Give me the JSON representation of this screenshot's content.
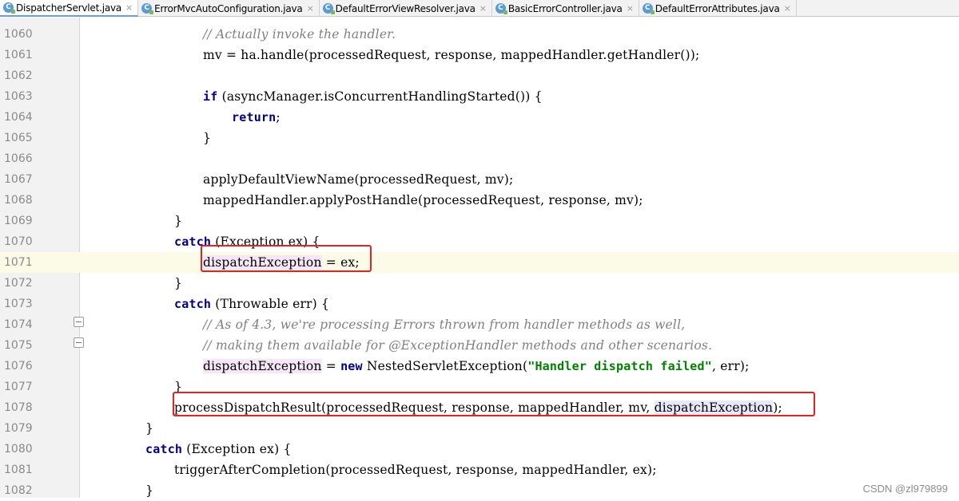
{
  "tabs": [
    {
      "label": "DispatcherServlet.java",
      "active": true
    },
    {
      "label": "ErrorMvcAutoConfiguration.java",
      "active": false
    },
    {
      "label": "DefaultErrorViewResolver.java",
      "active": false
    },
    {
      "label": "BasicErrorController.java",
      "active": false
    },
    {
      "label": "DefaultErrorAttributes.java",
      "active": false
    }
  ],
  "tab_icon_letter": "C",
  "tab_close_glyph": "×",
  "lines": [
    {
      "num": "1060",
      "text": "// Actually invoke the handler."
    },
    {
      "num": "1061",
      "text": "mv = ha.handle(processedRequest, response, mappedHandler.getHandler());"
    },
    {
      "num": "1062",
      "text": ""
    },
    {
      "num": "1063",
      "text_kw": "if",
      "text": " (asyncManager.isConcurrentHandlingStarted()) {"
    },
    {
      "num": "1064",
      "text_kw": "return",
      "text": ";"
    },
    {
      "num": "1065",
      "text": "}"
    },
    {
      "num": "1066",
      "text": ""
    },
    {
      "num": "1067",
      "text": "applyDefaultViewName(processedRequest, mv);"
    },
    {
      "num": "1068",
      "text": "mappedHandler.applyPostHandle(processedRequest, response, mv);"
    },
    {
      "num": "1069",
      "text": "}"
    },
    {
      "num": "1070",
      "text_kw": "catch",
      "text": " (Exception ex) {"
    },
    {
      "num": "1071",
      "text_var": "dispatchException",
      "text": " = ex;"
    },
    {
      "num": "1072",
      "text": "}"
    },
    {
      "num": "1073",
      "text_kw": "catch",
      "text": " (Throwable err) {"
    },
    {
      "num": "1074",
      "text": "// As of 4.3, we're processing Errors thrown from handler methods as well,"
    },
    {
      "num": "1075",
      "text": "// making them available for @ExceptionHandler methods and other scenarios."
    },
    {
      "num": "1076",
      "text_var": "dispatchException",
      "text_mid": " = ",
      "text_kw": "new",
      "text_mid2": " NestedServletException(",
      "text_str": "\"Handler dispatch failed\"",
      "text": ", err);"
    },
    {
      "num": "1077",
      "text": "}"
    },
    {
      "num": "1078",
      "text_pre": "processDispatchResult(processedRequest, response, mappedHandler, mv, ",
      "text_var": "dispatchException",
      "text": ");"
    },
    {
      "num": "1079",
      "text": "}"
    },
    {
      "num": "1080",
      "text_kw": "catch",
      "text": " (Exception ex) {"
    },
    {
      "num": "1081",
      "text": "triggerAfterCompletion(processedRequest, response, mappedHandler, ex);"
    },
    {
      "num": "1082",
      "text": "}"
    }
  ],
  "watermark": "CSDN @zl979899",
  "colors": {
    "keyword": "#000080",
    "comment": "#808080",
    "string": "#008000",
    "highlight_box": "#e02424",
    "current_line": "#fcfbe7",
    "var_highlight": "#f6e6f8"
  }
}
